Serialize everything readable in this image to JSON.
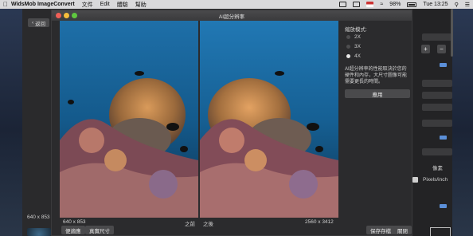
{
  "menubar": {
    "app_name": "WidsMob ImageConvert",
    "items": [
      "文件",
      "Edit",
      "體驗",
      "幫助"
    ],
    "battery": "98%",
    "clock": "Tue 13:25"
  },
  "main": {
    "back_label": "返回",
    "dimensions": "640 x 853 Px",
    "right_panel": {
      "unit_label": "像素",
      "resolution_unit": "Pixels/inch"
    }
  },
  "dialog": {
    "title": "AI超分辨率",
    "before": {
      "dim": "640 x 853",
      "label": "之前"
    },
    "after": {
      "label": "之後",
      "dim": "2560 x 3412"
    },
    "mode_title": "縮放模式:",
    "modes": [
      {
        "label": "2X",
        "selected": false
      },
      {
        "label": "3X",
        "selected": false
      },
      {
        "label": "4X",
        "selected": true
      }
    ],
    "note": "AI超分辨率的性能取決於您的硬件和內存，大尺寸圖像可能需要更長的時間。",
    "apply_label": "應用",
    "buttons": {
      "fit": "便適應",
      "actual": "真實尺寸",
      "save": "保存存檔",
      "close": "關閉"
    }
  },
  "colors": {
    "accent": "#5b8fd8",
    "close": "#ee5f57",
    "minimize": "#f6bd3b",
    "maximize": "#5fc73f"
  }
}
